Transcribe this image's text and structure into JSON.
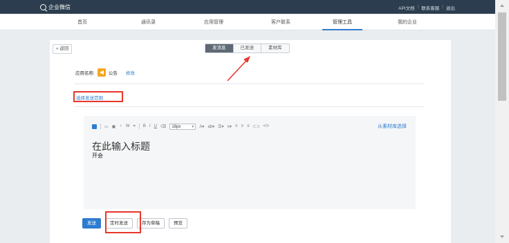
{
  "topbar": {
    "brand": "企业微信",
    "links": [
      "API文档",
      "联系客服",
      "退出"
    ],
    "separator": "|"
  },
  "nav": {
    "items": [
      "首页",
      "通讯录",
      "应用管理",
      "客户联系",
      "管理工具",
      "我的企业"
    ],
    "active": "管理工具"
  },
  "panel": {
    "back_label": "« 返回",
    "tabs": [
      "发消息",
      "已发送",
      "素材库"
    ],
    "active_tab": "发消息"
  },
  "app": {
    "label": "应用名称:",
    "name": "公告",
    "edit_label": "修改"
  },
  "scope": {
    "label": "选择发送范围"
  },
  "editor": {
    "font_size": "16px",
    "material_link": "从素材库选择",
    "title": "在此输入标题",
    "body": "开会",
    "toolbar_icons": [
      "block-icon",
      "image-icon",
      "video-icon",
      "voice-icon",
      "word-icon",
      "crop-icon",
      "bold-icon",
      "italic-icon",
      "underline-icon",
      "eraser-icon",
      "font-color-icon",
      "bg-color-icon",
      "list-icon",
      "indent-icon",
      "align-left-icon",
      "align-center-icon",
      "align-right-icon",
      "link-icon",
      "code-icon"
    ]
  },
  "actions": {
    "send": "发送",
    "schedule": "定时发送",
    "save_draft": "存为草稿",
    "preview": "预览"
  },
  "colors": {
    "topbar": "#2c3d4f",
    "accent": "#2d7cd0",
    "highlight": "#e8362b",
    "app_icon": "#f5a623"
  }
}
